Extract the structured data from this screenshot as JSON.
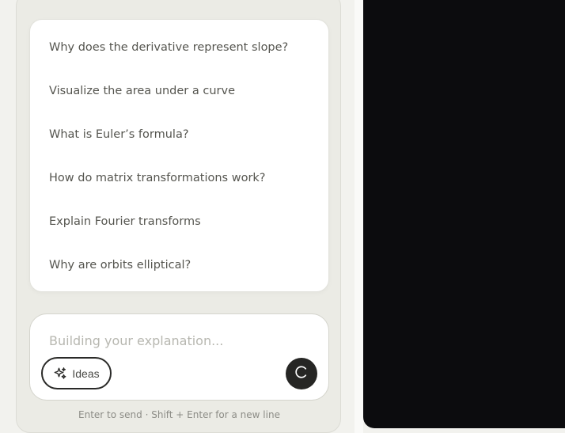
{
  "suggestions": [
    {
      "label": "Why does the derivative represent slope?"
    },
    {
      "label": "Visualize the area under a curve"
    },
    {
      "label": "What is Euler’s formula?"
    },
    {
      "label": "How do matrix transformations work?"
    },
    {
      "label": "Explain Fourier transforms"
    },
    {
      "label": "Why are orbits elliptical?"
    }
  ],
  "composer": {
    "placeholder": "Building your explanation...",
    "value": "",
    "ideas_label": "Ideas",
    "ideas_icon": "sparkle-icon",
    "submit_state_icon": "loading-spinner-icon"
  },
  "hint": "Enter to send · Shift + Enter for a new line",
  "colors": {
    "panel_background": "#ebebe5",
    "card_background": "#ffffff",
    "canvas_background": "#0c0c0e",
    "button_dark": "#262624"
  }
}
